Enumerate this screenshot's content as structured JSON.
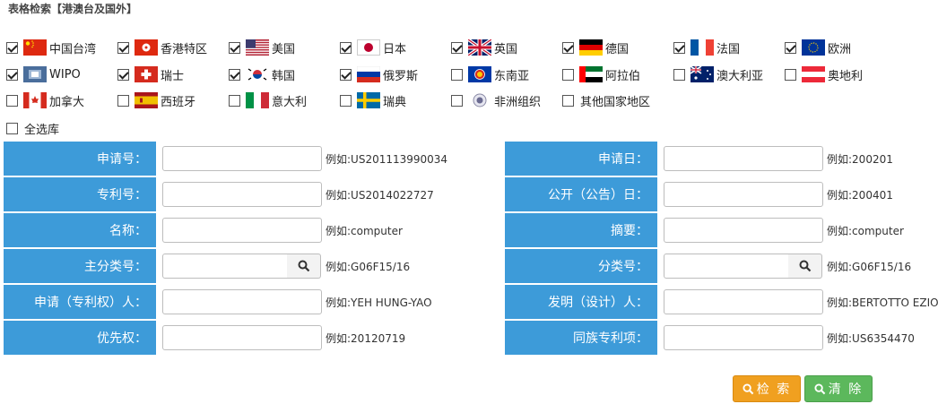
{
  "title": "表格检索【港澳台及国外】",
  "countries_row1": [
    {
      "label": "中国台湾",
      "checked": true,
      "flag": "flag-taiwan-icon"
    },
    {
      "label": "香港特区",
      "checked": true,
      "flag": "flag-hongkong-icon"
    },
    {
      "label": "美国",
      "checked": true,
      "flag": "flag-usa-icon"
    },
    {
      "label": "日本",
      "checked": true,
      "flag": "flag-japan-icon"
    },
    {
      "label": "英国",
      "checked": true,
      "flag": "flag-uk-icon"
    },
    {
      "label": "德国",
      "checked": true,
      "flag": "flag-germany-icon"
    },
    {
      "label": "法国",
      "checked": true,
      "flag": "flag-france-icon"
    },
    {
      "label": "欧洲",
      "checked": true,
      "flag": "flag-eu-icon"
    }
  ],
  "countries_row2": [
    {
      "label": "WIPO",
      "checked": true,
      "flag": "flag-wipo-icon"
    },
    {
      "label": "瑞士",
      "checked": true,
      "flag": "flag-switzerland-icon"
    },
    {
      "label": "韩国",
      "checked": true,
      "flag": "flag-korea-icon"
    },
    {
      "label": "俄罗斯",
      "checked": true,
      "flag": "flag-russia-icon"
    },
    {
      "label": "东南亚",
      "checked": false,
      "flag": "flag-asean-icon"
    },
    {
      "label": "阿拉伯",
      "checked": false,
      "flag": "flag-uae-icon"
    },
    {
      "label": "澳大利亚",
      "checked": false,
      "flag": "flag-australia-icon"
    },
    {
      "label": "奥地利",
      "checked": false,
      "flag": "flag-austria-icon"
    }
  ],
  "countries_row3": [
    {
      "label": "加拿大",
      "checked": false,
      "flag": "flag-canada-icon"
    },
    {
      "label": "西班牙",
      "checked": false,
      "flag": "flag-spain-icon"
    },
    {
      "label": "意大利",
      "checked": false,
      "flag": "flag-italy-icon"
    },
    {
      "label": "瑞典",
      "checked": false,
      "flag": "flag-sweden-icon"
    },
    {
      "label": "非洲组织",
      "checked": false,
      "flag": "flag-african-org-icon"
    },
    {
      "label": "其他国家地区",
      "checked": false,
      "flag": ""
    }
  ],
  "select_all": {
    "label": "全选库",
    "checked": false
  },
  "fields_left": [
    {
      "label": "申请号：",
      "example": "例如:US201113990034",
      "value": "",
      "has_search": false
    },
    {
      "label": "专利号：",
      "example": "例如:US2014022727",
      "value": "",
      "has_search": false
    },
    {
      "label": "名称：",
      "example": "例如:computer",
      "value": "",
      "has_search": false
    },
    {
      "label": "主分类号：",
      "example": "例如:G06F15/16",
      "value": "",
      "has_search": true
    },
    {
      "label": "申请（专利权）人：",
      "example": "例如:YEH HUNG-YAO",
      "value": "",
      "has_search": false
    },
    {
      "label": "优先权：",
      "example": "例如:20120719",
      "value": "",
      "has_search": false
    }
  ],
  "fields_right": [
    {
      "label": "申请日：",
      "example": "例如:200201",
      "value": "",
      "has_search": false
    },
    {
      "label": "公开（公告）日：",
      "example": "例如:200401",
      "value": "",
      "has_search": false
    },
    {
      "label": "摘要：",
      "example": "例如:computer",
      "value": "",
      "has_search": false
    },
    {
      "label": "分类号：",
      "example": "例如:G06F15/16",
      "value": "",
      "has_search": true
    },
    {
      "label": "发明（设计）人：",
      "example": "例如:BERTOTTO EZIO",
      "value": "",
      "has_search": false
    },
    {
      "label": "同族专利项：",
      "example": "例如:US6354470",
      "value": "",
      "has_search": false
    }
  ],
  "buttons": {
    "search": "检 索",
    "clear": "清 除"
  },
  "colors": {
    "label_bg": "#3d9bd9",
    "search_btn": "#f0a020",
    "clear_btn": "#5cb85c"
  }
}
